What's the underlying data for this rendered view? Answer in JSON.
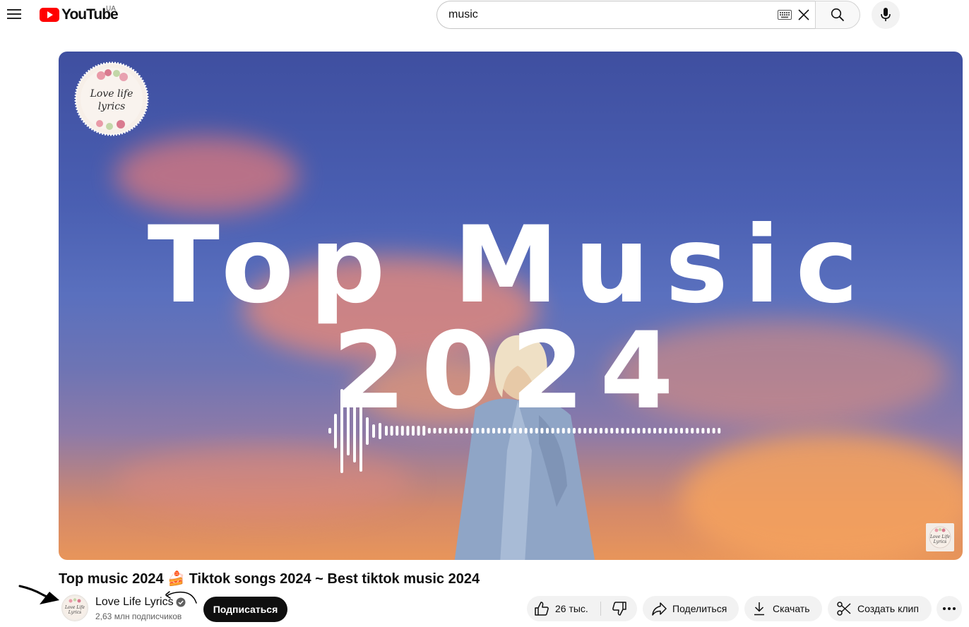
{
  "header": {
    "logo_text": "YouTube",
    "country_code": "UA",
    "search": {
      "value": "music",
      "placeholder": ""
    }
  },
  "video": {
    "art_title": "Top Music 2024",
    "title": "Top music 2024 🍰 Tiktok songs 2024 ~ Best tiktok music 2024",
    "channel_logo_text": "Love life lyrics",
    "watermark_text": "Love Life Lyrics"
  },
  "owner": {
    "channel_name": "Love Life Lyrics",
    "subscribers": "2,63 млн подписчиков",
    "avatar_text": "Love Life Lyrics",
    "subscribe_label": "Подписаться"
  },
  "actions": {
    "likes": "26 тыс.",
    "share_label": "Поделиться",
    "download_label": "Скачать",
    "clip_label": "Создать клип"
  },
  "colors": {
    "brand_red": "#ff0000",
    "subscribe_bg": "#0f0f0f",
    "pill_bg": "#f2f2f2"
  }
}
